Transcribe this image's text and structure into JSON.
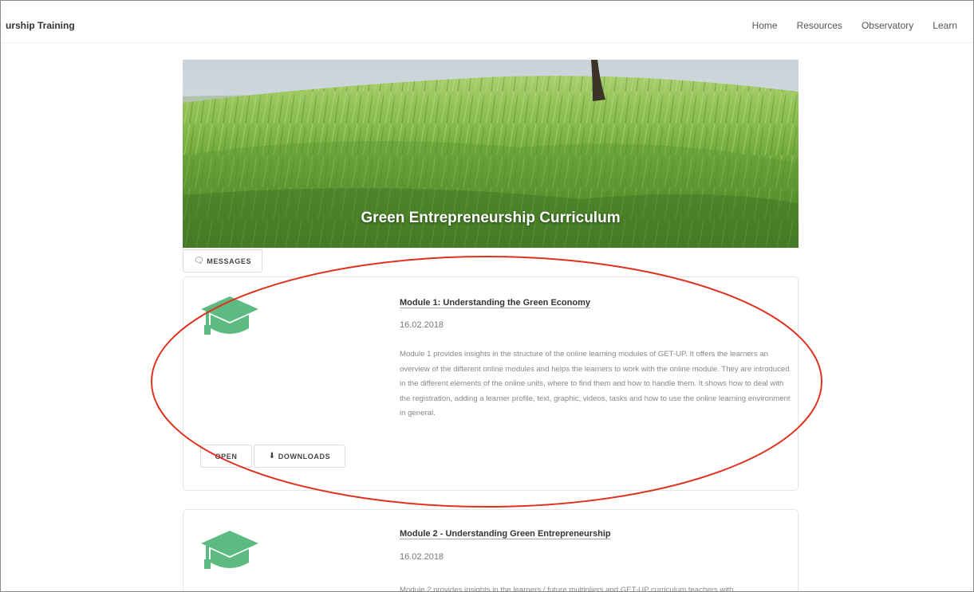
{
  "header": {
    "brand": "urship Training",
    "nav": [
      "Home",
      "Resources",
      "Observatory",
      "Learn"
    ]
  },
  "hero": {
    "title": "Green Entrepreneurship Curriculum"
  },
  "messages_button": {
    "label": "MESSAGES",
    "icon": "chat-bubbles-icon"
  },
  "modules": [
    {
      "title": "Module 1: Understanding the Green Economy",
      "date": "16.02.2018",
      "description": "Module 1 provides insights in the structure of the online learning modules of GET-UP. It offers the learners an overview of the different online modules and helps the learners to work with the online module. They are introduced in the different elements of the online units, where to find them and how to handle them. It shows how to deal with the registration, adding a learner profile, text, graphic, videos, tasks and how to use the online learning environment in general.",
      "open_label": "OPEN",
      "downloads_label": "DOWNLOADS"
    },
    {
      "title": "Module 2 - Understanding Green Entrepreneurship",
      "date": "16.02.2018",
      "description": "Module 2 provides insights in the learners / future multipliers and GET-UP curriculum teachers with"
    }
  ],
  "colors": {
    "accent_green": "#5dbb82",
    "annotation_red": "#e0301e"
  }
}
